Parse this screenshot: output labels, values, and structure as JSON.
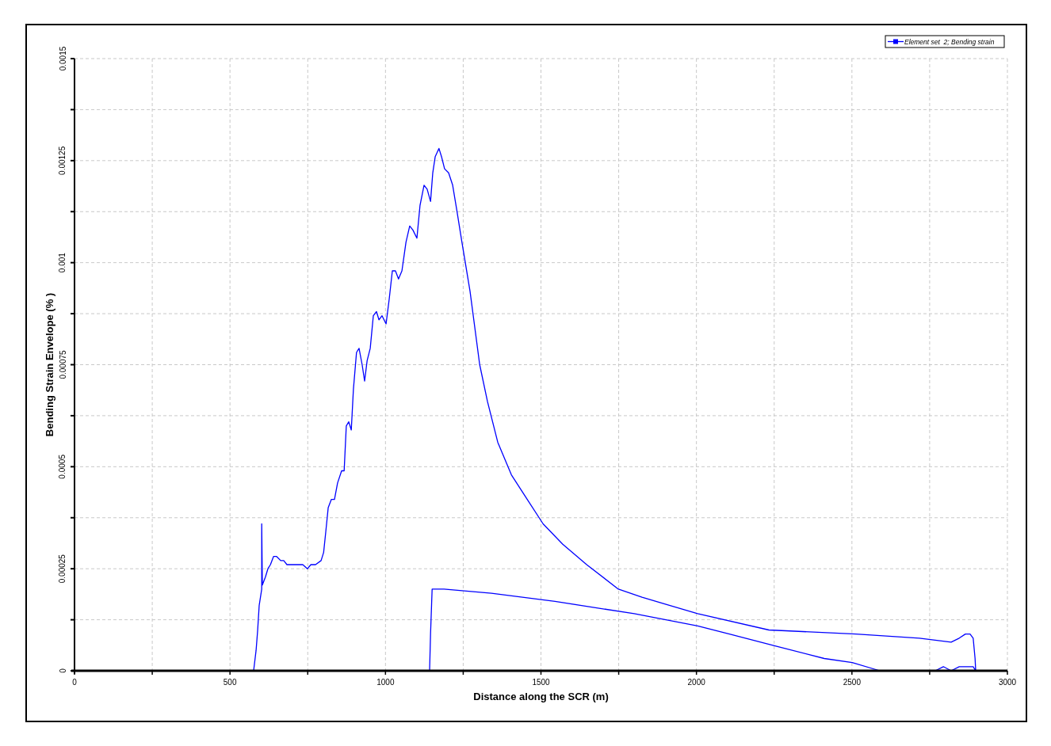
{
  "chart": {
    "chart_data": {
      "type": "line",
      "xlabel": "Distance along the SCR (m)",
      "ylabel": "Bending Strain Envelope (% )",
      "grid": true,
      "x": [
        576,
        584,
        589,
        594,
        602,
        602,
        604,
        614,
        622,
        630,
        640,
        650,
        663,
        673,
        683,
        698,
        716,
        734,
        749,
        760,
        775,
        793,
        801,
        808,
        816,
        826,
        836,
        846,
        859,
        867,
        874,
        882,
        890,
        897,
        907,
        915,
        925,
        933,
        941,
        951,
        961,
        971,
        979,
        989,
        1002,
        1012,
        1022,
        1032,
        1042,
        1053,
        1066,
        1078,
        1088,
        1101,
        1111,
        1124,
        1134,
        1145,
        1152,
        1160,
        1172,
        1180,
        1190,
        1203,
        1216,
        1229,
        1246,
        1272,
        1303,
        1328,
        1361,
        1405,
        1456,
        1507,
        1570,
        1647,
        1749,
        1825,
        2004,
        2233,
        2513,
        2717,
        2819,
        2845,
        2865,
        2880,
        2890,
        2896,
        2898,
        2890,
        2875,
        2857,
        2845,
        2819,
        2794,
        2768,
        2743,
        2590,
        2501,
        2411,
        2258,
        2106,
        2004,
        1800,
        1545,
        1341,
        1188,
        1150,
        1145,
        1142
      ],
      "series": [
        {
          "name": "Element set  2; Bending strain",
          "color": "#0000ff",
          "values": [
            0,
            5e-05,
            0.0001,
            0.00016,
            0.0002,
            0.00036,
            0.00021,
            0.00023,
            0.00025,
            0.00026,
            0.00028,
            0.00028,
            0.00027,
            0.00027,
            0.00026,
            0.00026,
            0.00026,
            0.00026,
            0.00025,
            0.00026,
            0.00026,
            0.00027,
            0.00029,
            0.00034,
            0.0004,
            0.00042,
            0.00042,
            0.00046,
            0.00049,
            0.00049,
            0.0006,
            0.00061,
            0.00059,
            0.00069,
            0.00078,
            0.00079,
            0.00075,
            0.00071,
            0.00076,
            0.00079,
            0.00087,
            0.00088,
            0.00086,
            0.00087,
            0.00085,
            0.00091,
            0.00098,
            0.00098,
            0.00096,
            0.00098,
            0.00105,
            0.00109,
            0.00108,
            0.00106,
            0.00114,
            0.00119,
            0.00118,
            0.00115,
            0.00122,
            0.00126,
            0.00128,
            0.00126,
            0.00123,
            0.00122,
            0.00119,
            0.00113,
            0.00105,
            0.00093,
            0.00075,
            0.00066,
            0.00056,
            0.00048,
            0.00042,
            0.00036,
            0.00031,
            0.00026,
            0.0002,
            0.00018,
            0.00014,
            0.0001,
            9e-05,
            8e-05,
            7e-05,
            8e-05,
            9e-05,
            9e-05,
            8e-05,
            3e-05,
            0,
            1e-05,
            1e-05,
            1e-05,
            1e-05,
            0,
            1e-05,
            0,
            0,
            0,
            2e-05,
            3e-05,
            6e-05,
            9e-05,
            0.00011,
            0.00014,
            0.00017,
            0.00019,
            0.0002,
            0.0002,
            9e-05,
            0
          ]
        }
      ],
      "xlim": [
        0,
        3000
      ],
      "ylim": [
        0,
        0.0015
      ],
      "xticks": [
        0,
        500,
        1000,
        1500,
        2000,
        2500,
        3000
      ],
      "yticks": [
        0,
        0.00025,
        0.0005,
        0.00075,
        0.001,
        0.00125,
        0.0015
      ]
    }
  }
}
